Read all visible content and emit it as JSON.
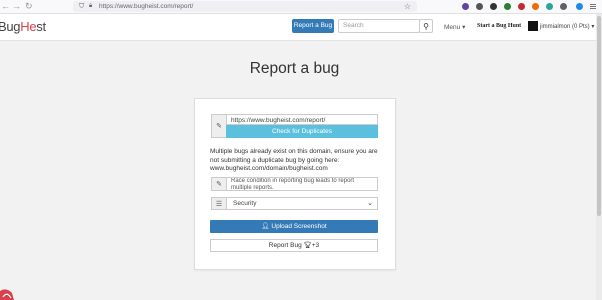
{
  "browser": {
    "url": "https://www.bugheist.com/report/",
    "back_icon": "arrow-left",
    "forward_icon": "arrow-right",
    "reload_icon": "reload"
  },
  "navbar": {
    "logo": {
      "main": "Bug",
      "accent": "He",
      "tail": "st"
    },
    "report_button": "Report a Bug",
    "search_placeholder": "Search",
    "search_icon": "magnifier",
    "menu_label": "Menu ▾",
    "start_bughunt": "Start a Bug Hunt",
    "user_label": "jimmialmon (0 Pts) ▾"
  },
  "page": {
    "title": "Report a bug"
  },
  "form": {
    "url_value": "https://www.bugheist.com/report/",
    "check_duplicates": "Check for Duplicates",
    "notice": "Multiple bugs already exist on this domain, ensure you are not submitting a duplicate bug by going here: www.bugheist.com/domain/bugheist.com",
    "description_value": "Race condition in reporting bug leads to report multiple reports.",
    "category_selected": "Security",
    "upload_button": "Upload Screenshot",
    "submit_button": "Report Bug",
    "submit_points": "+3"
  },
  "colors": {
    "primary": "#337ab7",
    "info": "#5bc0de",
    "brand": "#d9414b"
  }
}
